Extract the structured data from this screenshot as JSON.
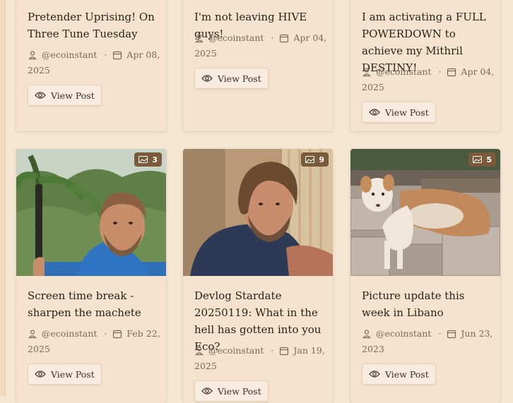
{
  "ui": {
    "view_label": "View Post",
    "separator": "·"
  },
  "cards": [
    {
      "title": "Pretender Uprising! On Three Tune Tuesday",
      "author": "@ecoinstant",
      "date_a": "Apr 08,",
      "date_b": "2025"
    },
    {
      "title": "I'm not leaving HIVE guys!",
      "author": "@ecoinstant",
      "date_a": "Apr 04,",
      "date_b": "2025"
    },
    {
      "title": "I am activating a FULL POWERDOWN to achieve my Mithril DESTINY!",
      "author": "@ecoinstant",
      "date_a": "Apr 04,",
      "date_b": "2025"
    },
    {
      "title": "Screen time break - sharpen the machete",
      "author": "@ecoinstant",
      "date_a": "Feb 22,",
      "date_b": "2025",
      "image_count": "3"
    },
    {
      "title": "Devlog Stardate 20250119: What in the hell has gotten into you Eco?",
      "author": "@ecoinstant",
      "date_a": "Jan 19,",
      "date_b": "2025",
      "image_count": "9"
    },
    {
      "title": "Picture update this week in Libano",
      "author": "@ecoinstant",
      "date_a": "Jun 23,",
      "date_b": "2023",
      "image_count": "5"
    }
  ],
  "icons": {
    "user": "user-icon",
    "calendar": "calendar-icon",
    "eye": "eye-icon",
    "images": "images-icon"
  }
}
